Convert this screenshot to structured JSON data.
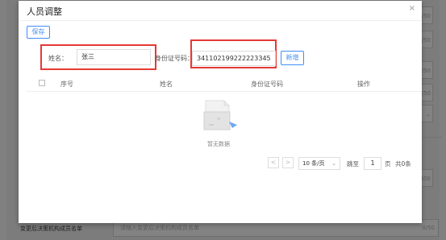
{
  "background": {
    "field_counters": [
      "0/50",
      "0/50",
      "0/50",
      "0/50",
      "0/300"
    ],
    "bottom_label": "变更后决策机构成员名单",
    "bottom_placeholder": "请输入变更后决策机构成员名单",
    "bottom_counter": "0/50"
  },
  "modal": {
    "title": "人员调整",
    "close": "×",
    "save_label": "保存",
    "name_label": "姓名：",
    "name_value": "张三",
    "id_label": "身份证号码：",
    "id_value": "341102199222223345",
    "add_label": "新增",
    "table": {
      "columns": [
        "序号",
        "姓名",
        "身份证号码",
        "操作"
      ],
      "empty_text": "暂无数据"
    },
    "pagination": {
      "prev": "<",
      "next": ">",
      "page_size": "10 条/页",
      "jump_label": "跳至",
      "jump_value": "1",
      "page_suffix": "页",
      "total": "共0条"
    }
  },
  "colors": {
    "accent": "#3e8ef7",
    "highlight_box": "#e53935"
  }
}
